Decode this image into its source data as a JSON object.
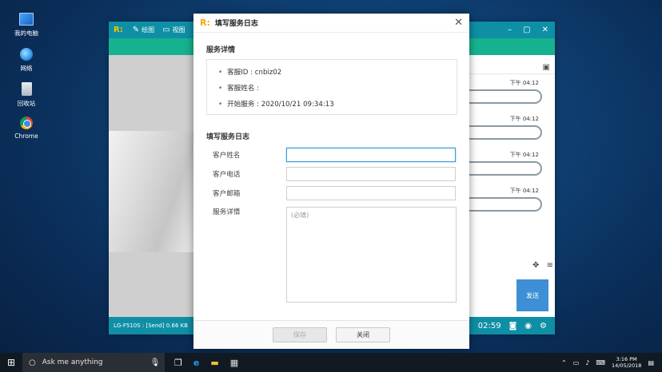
{
  "desktop": {
    "icons": [
      {
        "label": "我的电脑",
        "icon": "computer-icon"
      },
      {
        "label": "网络",
        "icon": "network-icon"
      },
      {
        "label": "回收站",
        "icon": "recycle-bin-icon"
      },
      {
        "label": "Chrome",
        "icon": "chrome-icon"
      }
    ]
  },
  "app": {
    "logo": "R:",
    "tools": [
      {
        "label": "绘图",
        "icon": "pencil-icon"
      },
      {
        "label": "视图",
        "icon": "monitor-icon"
      }
    ],
    "chat_times": [
      "下午 04:12",
      "下午 04:12",
      "下午 04:12",
      "下午 04:12"
    ],
    "send_label": "发送",
    "status_text": "LG-F510S : [Send] 0.66 KB",
    "timer": "02:59"
  },
  "dialog": {
    "logo": "R:",
    "title": "填写服务日志",
    "detail_heading": "服务详情",
    "details": [
      "客服ID : cnbiz02",
      "客服姓名 :",
      "开始服务 : 2020/10/21 09:34:13"
    ],
    "log_heading": "填写服务日志",
    "fields": {
      "customer_name": {
        "label": "客户姓名",
        "value": ""
      },
      "customer_phone": {
        "label": "客户电话",
        "value": ""
      },
      "customer_email": {
        "label": "客户邮箱",
        "value": ""
      },
      "service_details": {
        "label": "服务详情",
        "placeholder": "(必填)"
      }
    },
    "save_label": "保存",
    "close_label": "关闭"
  },
  "taskbar": {
    "search_text": "Ask me anything",
    "clock_time": "3:16 PM",
    "clock_date": "14/05/2018"
  }
}
